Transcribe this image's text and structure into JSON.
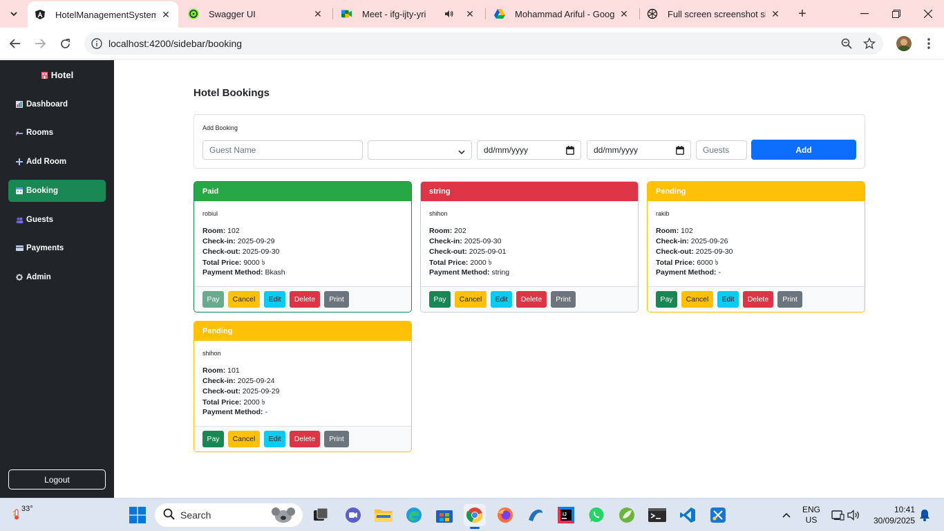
{
  "browser": {
    "tabs": [
      {
        "title": "HotelManagementSystem",
        "icon": "angular-icon",
        "active": true
      },
      {
        "title": "Swagger UI",
        "icon": "swagger-icon",
        "active": false
      },
      {
        "title": "Meet - ifg-ijty-yri",
        "icon": "google-meet-icon",
        "active": false
      },
      {
        "title": "Mohammad Ariful - Google",
        "icon": "google-drive-icon",
        "active": false
      },
      {
        "title": "Full screen screenshot shortc",
        "icon": "chatgpt-icon",
        "active": false
      }
    ],
    "url": "localhost:4200/sidebar/booking"
  },
  "sidebar": {
    "brand": "Hotel",
    "brand_icon": "hotel-icon",
    "items": [
      {
        "label": "Dashboard",
        "icon": "chart-icon",
        "active": false
      },
      {
        "label": "Rooms",
        "icon": "bed-icon",
        "active": false
      },
      {
        "label": "Add Room",
        "icon": "plus-icon",
        "active": false
      },
      {
        "label": "Booking",
        "icon": "calendar-icon",
        "active": true
      },
      {
        "label": "Guests",
        "icon": "people-icon",
        "active": false
      },
      {
        "label": "Payments",
        "icon": "card-icon",
        "active": false
      },
      {
        "label": "Admin",
        "icon": "gear-icon",
        "active": false
      }
    ],
    "logout": "Logout"
  },
  "main": {
    "title": "Hotel Bookings",
    "form": {
      "label": "Add Booking",
      "guest_placeholder": "Guest Name",
      "room_select": "",
      "checkin_placeholder": "dd/mm/yyyy",
      "checkout_placeholder": "dd/mm/yyyy",
      "guests_placeholder": "Guests",
      "add_label": "Add"
    },
    "field_labels": {
      "room": "Room:",
      "checkin": "Check-in:",
      "checkout": "Check-out:",
      "total": "Total Price:",
      "method": "Payment Method:"
    },
    "actions": {
      "pay": "Pay",
      "cancel": "Cancel",
      "edit": "Edit",
      "delete": "Delete",
      "print": "Print"
    },
    "bookings": [
      {
        "status": "Paid",
        "guest": "robiul",
        "room": "102",
        "checkin": "2025-09-29",
        "checkout": "2025-09-30",
        "total": "9000 ৳",
        "method": "Bkash"
      },
      {
        "status": "string",
        "guest": "shihon",
        "room": "202",
        "checkin": "2025-09-30",
        "checkout": "2025-09-01",
        "total": "2000 ৳",
        "method": "string"
      },
      {
        "status": "Pending",
        "guest": "rakib",
        "room": "102",
        "checkin": "2025-09-26",
        "checkout": "2025-09-30",
        "total": "6000 ৳",
        "method": "-"
      },
      {
        "status": "Pending",
        "guest": "shihon",
        "room": "101",
        "checkin": "2025-09-24",
        "checkout": "2025-09-29",
        "total": "2000 ৳",
        "method": "-"
      }
    ]
  },
  "taskbar": {
    "weather": "33°",
    "search_label": "Search",
    "lang": "ENG",
    "region": "US",
    "time": "10:41",
    "date": "30/09/2025"
  },
  "colors": {
    "paid": "#28a745",
    "danger": "#dc3545",
    "warning": "#ffc107",
    "success": "#198754",
    "info": "#0dcaf0",
    "secondary": "#6c757d",
    "primary": "#0d6efd"
  }
}
